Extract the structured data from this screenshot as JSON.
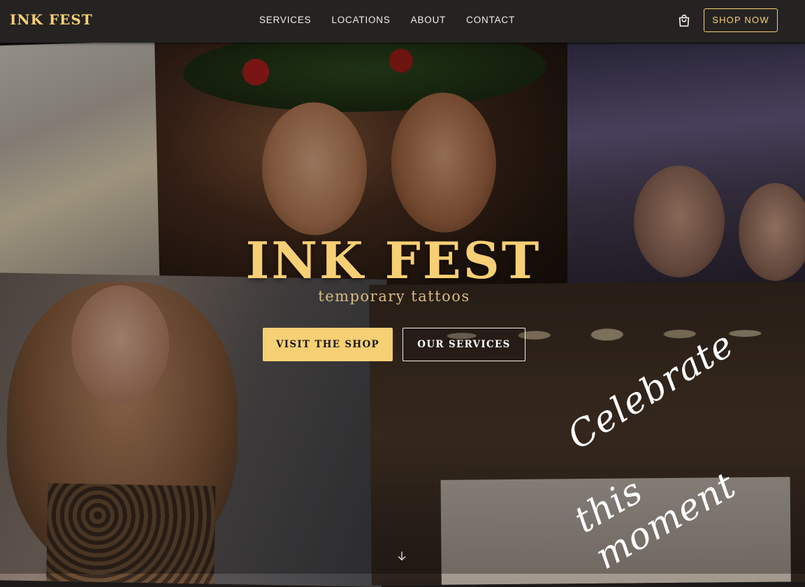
{
  "brand": {
    "name": "INK FEST"
  },
  "nav": {
    "items": [
      "SERVICES",
      "LOCATIONS",
      "ABOUT",
      "CONTACT"
    ],
    "cart_icon": "shopping-bag-icon",
    "cta_label": "SHOP NOW"
  },
  "hero": {
    "title": "INK FEST",
    "subtitle": "temporary tattoos",
    "primary_button": "VISIT THE SHOP",
    "secondary_button": "OUR SERVICES",
    "script_line1": "Celebrate",
    "script_line2": "this moment",
    "scroll_icon": "arrow-down-icon"
  },
  "colors": {
    "accent": "#f7cf74",
    "nav_bg": "#252322",
    "text_light": "#f2efe9"
  }
}
